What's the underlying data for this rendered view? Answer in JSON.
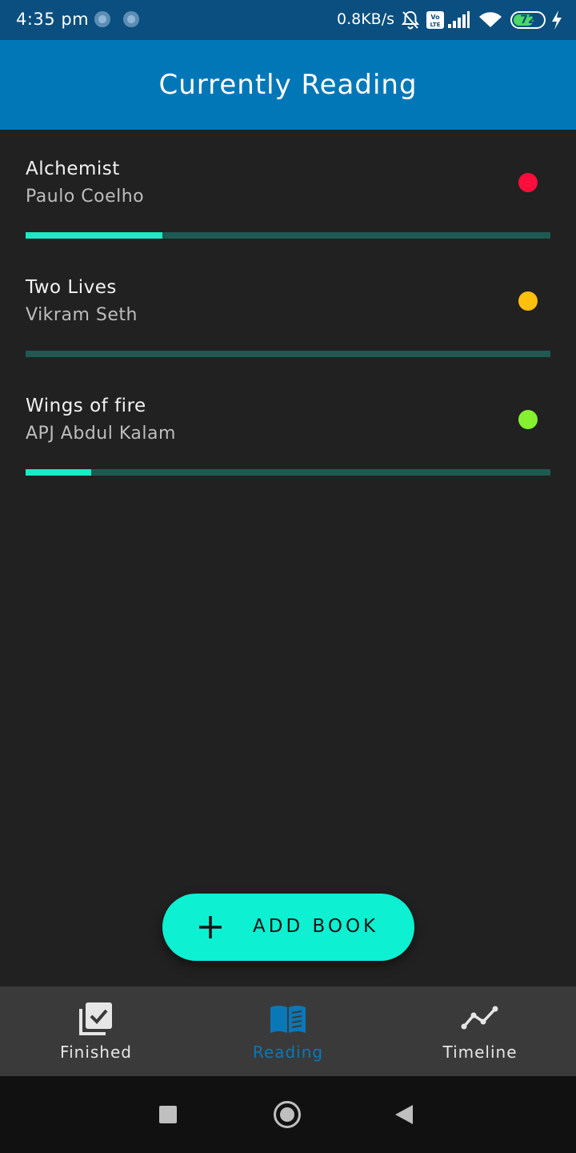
{
  "status_bar": {
    "time": "4:35 pm",
    "network_speed": "0.8KB/s",
    "battery_level": "72",
    "battery_percent": 72,
    "icons": [
      "notification-dot-icon",
      "notification-dot-icon",
      "mute-bell-icon",
      "volte-icon",
      "signal-icon",
      "wifi-icon",
      "battery-icon",
      "charging-bolt-icon"
    ]
  },
  "app_bar": {
    "title": "Currently Reading"
  },
  "books": [
    {
      "title": "Alchemist",
      "author": "Paulo Coelho",
      "status_color": "#ff0d3c",
      "progress": 0.26
    },
    {
      "title": "Two Lives",
      "author": "Vikram Seth",
      "status_color": "#ffbf0d",
      "progress": 0.0
    },
    {
      "title": "Wings of fire",
      "author": "APJ Abdul Kalam",
      "status_color": "#86f22f",
      "progress": 0.125
    }
  ],
  "fab": {
    "label": "ADD BOOK",
    "icon": "plus-icon"
  },
  "bottom_nav": {
    "items": [
      {
        "label": "Finished",
        "icon": "checkbox-stack-icon",
        "active": false
      },
      {
        "label": "Reading",
        "icon": "open-book-icon",
        "active": true
      },
      {
        "label": "Timeline",
        "icon": "line-chart-icon",
        "active": false
      }
    ]
  },
  "colors": {
    "status_bar": "#0a4f7f",
    "app_bar": "#0277b8",
    "background": "#212121",
    "accent": "#1de9c4",
    "fab": "#0df0d2",
    "nav_active": "#0a78b8"
  }
}
